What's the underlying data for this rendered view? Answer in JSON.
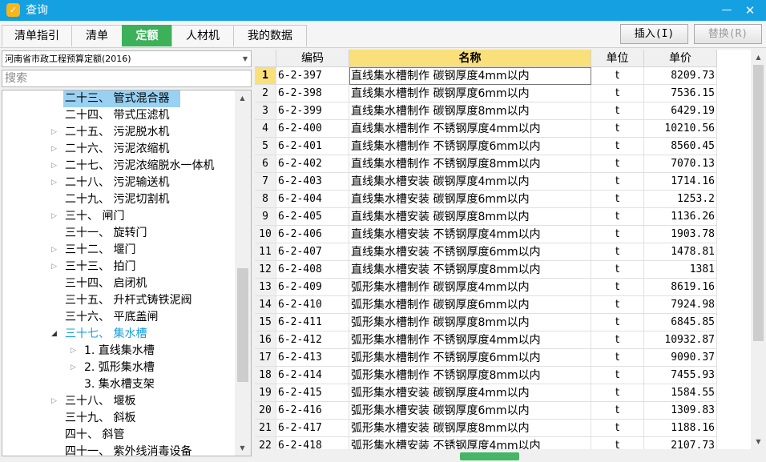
{
  "window": {
    "title": "查询",
    "minimize": "—",
    "close": "✕"
  },
  "tabs": [
    {
      "label": "清单指引"
    },
    {
      "label": "清单"
    },
    {
      "label": "定额"
    },
    {
      "label": "人材机"
    },
    {
      "label": "我的数据"
    }
  ],
  "toolbar": {
    "insert": "插入(I)",
    "replace": "替换(R)"
  },
  "left_panel": {
    "quota_library": "河南省市政工程预算定额(2016)",
    "search_placeholder": "搜索",
    "tree": [
      {
        "label": "二十三、  管式混合器",
        "has_children": false,
        "selected": true
      },
      {
        "label": "二十四、  带式压滤机",
        "has_children": false
      },
      {
        "label": "二十五、  污泥脱水机",
        "has_children": true
      },
      {
        "label": "二十六、  污泥浓缩机",
        "has_children": true
      },
      {
        "label": "二十七、  污泥浓缩脱水一体机",
        "has_children": true
      },
      {
        "label": "二十八、  污泥输送机",
        "has_children": true
      },
      {
        "label": "二十九、  污泥切割机",
        "has_children": false
      },
      {
        "label": "三十、  闸门",
        "has_children": true
      },
      {
        "label": "三十一、  旋转门",
        "has_children": false
      },
      {
        "label": "三十二、  堰门",
        "has_children": true
      },
      {
        "label": "三十三、  拍门",
        "has_children": true
      },
      {
        "label": "三十四、  启闭机",
        "has_children": false
      },
      {
        "label": "三十五、  升杆式铸铁泥阀",
        "has_children": false
      },
      {
        "label": "三十六、  平底盖闸",
        "has_children": false
      },
      {
        "label": "三十七、  集水槽",
        "has_children": true,
        "expanded": true,
        "current": true
      },
      {
        "label": "1.  直线集水槽",
        "has_children": true,
        "child": true
      },
      {
        "label": "2.  弧形集水槽",
        "has_children": true,
        "child": true
      },
      {
        "label": "3.  集水槽支架",
        "has_children": false,
        "child": true
      },
      {
        "label": "三十八、  堰板",
        "has_children": true
      },
      {
        "label": "三十九、  斜板",
        "has_children": false
      },
      {
        "label": "四十、  斜管",
        "has_children": false
      },
      {
        "label": "四十一、  紫外线消毒设备",
        "has_children": false
      }
    ]
  },
  "grid": {
    "headers": {
      "code": "编码",
      "name": "名称",
      "unit": "单位",
      "price": "单价"
    },
    "rows": [
      {
        "num": "1",
        "code": "6-2-397",
        "name": "直线集水槽制作  碳钢厚度4mm以内",
        "unit": "t",
        "price": "8209.73"
      },
      {
        "num": "2",
        "code": "6-2-398",
        "name": "直线集水槽制作  碳钢厚度6mm以内",
        "unit": "t",
        "price": "7536.15"
      },
      {
        "num": "3",
        "code": "6-2-399",
        "name": "直线集水槽制作  碳钢厚度8mm以内",
        "unit": "t",
        "price": "6429.19"
      },
      {
        "num": "4",
        "code": "6-2-400",
        "name": "直线集水槽制作  不锈钢厚度4mm以内",
        "unit": "t",
        "price": "10210.56"
      },
      {
        "num": "5",
        "code": "6-2-401",
        "name": "直线集水槽制作  不锈钢厚度6mm以内",
        "unit": "t",
        "price": "8560.45"
      },
      {
        "num": "6",
        "code": "6-2-402",
        "name": "直线集水槽制作  不锈钢厚度8mm以内",
        "unit": "t",
        "price": "7070.13"
      },
      {
        "num": "7",
        "code": "6-2-403",
        "name": "直线集水槽安装  碳钢厚度4mm以内",
        "unit": "t",
        "price": "1714.16"
      },
      {
        "num": "8",
        "code": "6-2-404",
        "name": "直线集水槽安装  碳钢厚度6mm以内",
        "unit": "t",
        "price": "1253.2"
      },
      {
        "num": "9",
        "code": "6-2-405",
        "name": "直线集水槽安装  碳钢厚度8mm以内",
        "unit": "t",
        "price": "1136.26"
      },
      {
        "num": "10",
        "code": "6-2-406",
        "name": "直线集水槽安装  不锈钢厚度4mm以内",
        "unit": "t",
        "price": "1903.78"
      },
      {
        "num": "11",
        "code": "6-2-407",
        "name": "直线集水槽安装  不锈钢厚度6mm以内",
        "unit": "t",
        "price": "1478.81"
      },
      {
        "num": "12",
        "code": "6-2-408",
        "name": "直线集水槽安装  不锈钢厚度8mm以内",
        "unit": "t",
        "price": "1381"
      },
      {
        "num": "13",
        "code": "6-2-409",
        "name": "弧形集水槽制作  碳钢厚度4mm以内",
        "unit": "t",
        "price": "8619.16"
      },
      {
        "num": "14",
        "code": "6-2-410",
        "name": "弧形集水槽制作  碳钢厚度6mm以内",
        "unit": "t",
        "price": "7924.98"
      },
      {
        "num": "15",
        "code": "6-2-411",
        "name": "弧形集水槽制作  碳钢厚度8mm以内",
        "unit": "t",
        "price": "6845.85"
      },
      {
        "num": "16",
        "code": "6-2-412",
        "name": "弧形集水槽制作  不锈钢厚度4mm以内",
        "unit": "t",
        "price": "10932.87"
      },
      {
        "num": "17",
        "code": "6-2-413",
        "name": "弧形集水槽制作  不锈钢厚度6mm以内",
        "unit": "t",
        "price": "9090.37"
      },
      {
        "num": "18",
        "code": "6-2-414",
        "name": "弧形集水槽制作  不锈钢厚度8mm以内",
        "unit": "t",
        "price": "7455.93"
      },
      {
        "num": "19",
        "code": "6-2-415",
        "name": "弧形集水槽安装  碳钢厚度4mm以内",
        "unit": "t",
        "price": "1584.55"
      },
      {
        "num": "20",
        "code": "6-2-416",
        "name": "弧形集水槽安装  碳钢厚度6mm以内",
        "unit": "t",
        "price": "1309.83"
      },
      {
        "num": "21",
        "code": "6-2-417",
        "name": "弧形集水槽安装  碳钢厚度8mm以内",
        "unit": "t",
        "price": "1188.16"
      },
      {
        "num": "22",
        "code": "6-2-418",
        "name": "弧形集水槽安装  不锈钢厚度4mm以内",
        "unit": "t",
        "price": "2107.73"
      }
    ]
  },
  "colors": {
    "title_bar": "#14a0e1",
    "active_tab": "#3db15a",
    "header_highlight": "#f9e07a",
    "tree_selection": "#99d1f3",
    "tree_current": "#1a9fdb"
  }
}
